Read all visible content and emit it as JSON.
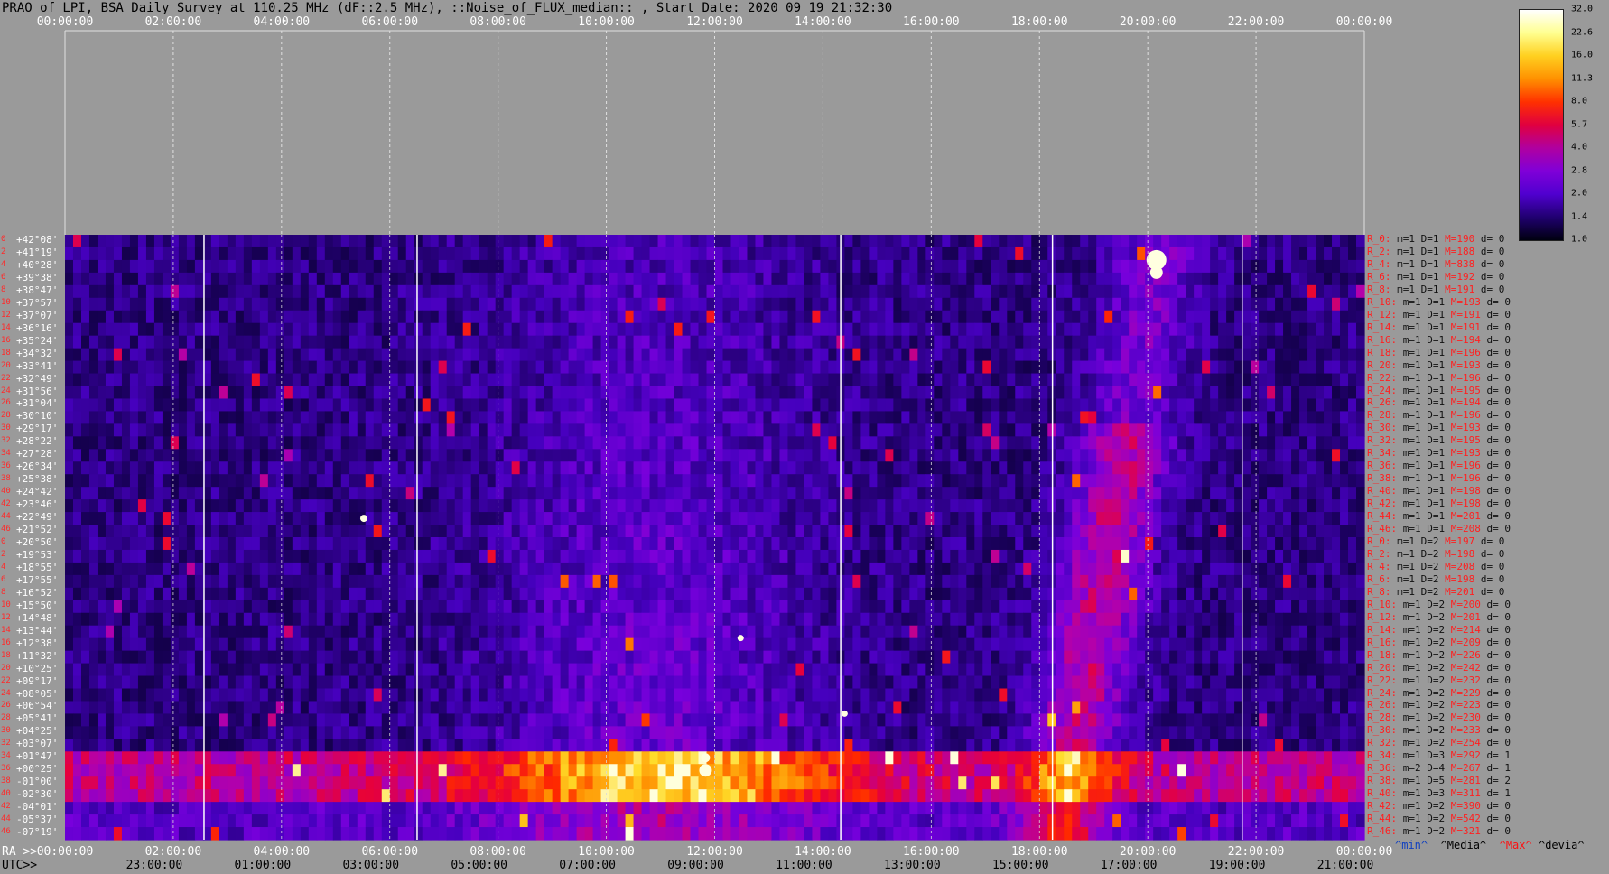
{
  "title": "PRAO of LPI, BSA Daily Survey at 110.25 MHz (dF::2.5 MHz), ::Noise_of_FLUX_median:: , Start Date: 2020 09 19 21:32:30",
  "chart_data": {
    "type": "heatmap",
    "top_axis_ticks": [
      "00:00:00",
      "02:00:00",
      "04:00:00",
      "06:00:00",
      "08:00:00",
      "10:00:00",
      "12:00:00",
      "14:00:00",
      "16:00:00",
      "18:00:00",
      "20:00:00",
      "22:00:00",
      "00:00:00"
    ],
    "ra_axis_label": "RA >>",
    "ra_axis_ticks": [
      "00:00:00",
      "02:00:00",
      "04:00:00",
      "06:00:00",
      "08:00:00",
      "10:00:00",
      "12:00:00",
      "14:00:00",
      "16:00:00",
      "18:00:00",
      "20:00:00",
      "22:00:00",
      "00:00:00"
    ],
    "utc_axis_label": "UTC>>",
    "utc_axis_ticks": [
      "23:00:00",
      "01:00:00",
      "03:00:00",
      "05:00:00",
      "07:00:00",
      "09:00:00",
      "11:00:00",
      "13:00:00",
      "15:00:00",
      "17:00:00",
      "19:00:00",
      "21:00:00"
    ],
    "declinations": [
      "+42°08'",
      "+41°19'",
      "+40°28'",
      "+39°38'",
      "+38°47'",
      "+37°57'",
      "+37°07'",
      "+36°16'",
      "+35°24'",
      "+34°32'",
      "+33°41'",
      "+32°49'",
      "+31°56'",
      "+31°04'",
      "+30°10'",
      "+29°17'",
      "+28°22'",
      "+27°28'",
      "+26°34'",
      "+25°38'",
      "+24°42'",
      "+23°46'",
      "+22°49'",
      "+21°52'",
      "+20°50'",
      "+19°53'",
      "+18°55'",
      "+17°55'",
      "+16°52'",
      "+15°50'",
      "+14°48'",
      "+13°44'",
      "+12°38'",
      "+11°32'",
      "+10°25'",
      "+09°17'",
      "+08°05'",
      "+06°54'",
      "+05°41'",
      "+04°25'",
      "+03°07'",
      "+01°47'",
      "+00°25'",
      "-01°00'",
      "-02°30'",
      "-04°01'",
      "-05°37'",
      "-07°19'"
    ],
    "row_indices": [
      "0",
      "2",
      "4",
      "6",
      "8",
      "10",
      "12",
      "14",
      "16",
      "18",
      "20",
      "22",
      "24",
      "26",
      "28",
      "30",
      "32",
      "34",
      "36",
      "38",
      "40",
      "42",
      "44",
      "46",
      "0",
      "2",
      "4",
      "6",
      "8",
      "10",
      "12",
      "14",
      "16",
      "18",
      "20",
      "22",
      "24",
      "26",
      "28",
      "30",
      "32",
      "34",
      "36",
      "38",
      "40",
      "42",
      "44",
      "46"
    ],
    "row_stats": [
      {
        "r": "R_0:",
        "m": "m=1",
        "D": "D=1",
        "M": "M=190",
        "d": "d= 0"
      },
      {
        "r": "R_2:",
        "m": "m=1",
        "D": "D=1",
        "M": "M=188",
        "d": "d= 0"
      },
      {
        "r": "R_4:",
        "m": "m=1",
        "D": "D=1",
        "M": "M=838",
        "d": "d= 0"
      },
      {
        "r": "R_6:",
        "m": "m=1",
        "D": "D=1",
        "M": "M=192",
        "d": "d= 0"
      },
      {
        "r": "R_8:",
        "m": "m=1",
        "D": "D=1",
        "M": "M=191",
        "d": "d= 0"
      },
      {
        "r": "R_10:",
        "m": "m=1",
        "D": "D=1",
        "M": "M=193",
        "d": "d= 0"
      },
      {
        "r": "R_12:",
        "m": "m=1",
        "D": "D=1",
        "M": "M=191",
        "d": "d= 0"
      },
      {
        "r": "R_14:",
        "m": "m=1",
        "D": "D=1",
        "M": "M=191",
        "d": "d= 0"
      },
      {
        "r": "R_16:",
        "m": "m=1",
        "D": "D=1",
        "M": "M=194",
        "d": "d= 0"
      },
      {
        "r": "R_18:",
        "m": "m=1",
        "D": "D=1",
        "M": "M=196",
        "d": "d= 0"
      },
      {
        "r": "R_20:",
        "m": "m=1",
        "D": "D=1",
        "M": "M=193",
        "d": "d= 0"
      },
      {
        "r": "R_22:",
        "m": "m=1",
        "D": "D=1",
        "M": "M=196",
        "d": "d= 0"
      },
      {
        "r": "R_24:",
        "m": "m=1",
        "D": "D=1",
        "M": "M=195",
        "d": "d= 0"
      },
      {
        "r": "R_26:",
        "m": "m=1",
        "D": "D=1",
        "M": "M=194",
        "d": "d= 0"
      },
      {
        "r": "R_28:",
        "m": "m=1",
        "D": "D=1",
        "M": "M=196",
        "d": "d= 0"
      },
      {
        "r": "R_30:",
        "m": "m=1",
        "D": "D=1",
        "M": "M=193",
        "d": "d= 0"
      },
      {
        "r": "R_32:",
        "m": "m=1",
        "D": "D=1",
        "M": "M=195",
        "d": "d= 0"
      },
      {
        "r": "R_34:",
        "m": "m=1",
        "D": "D=1",
        "M": "M=193",
        "d": "d= 0"
      },
      {
        "r": "R_36:",
        "m": "m=1",
        "D": "D=1",
        "M": "M=196",
        "d": "d= 0"
      },
      {
        "r": "R_38:",
        "m": "m=1",
        "D": "D=1",
        "M": "M=196",
        "d": "d= 0"
      },
      {
        "r": "R_40:",
        "m": "m=1",
        "D": "D=1",
        "M": "M=198",
        "d": "d= 0"
      },
      {
        "r": "R_42:",
        "m": "m=1",
        "D": "D=1",
        "M": "M=198",
        "d": "d= 0"
      },
      {
        "r": "R_44:",
        "m": "m=1",
        "D": "D=1",
        "M": "M=201",
        "d": "d= 0"
      },
      {
        "r": "R_46:",
        "m": "m=1",
        "D": "D=1",
        "M": "M=208",
        "d": "d= 0"
      },
      {
        "r": "R_0:",
        "m": "m=1",
        "D": "D=2",
        "M": "M=197",
        "d": "d= 0"
      },
      {
        "r": "R_2:",
        "m": "m=1",
        "D": "D=2",
        "M": "M=198",
        "d": "d= 0"
      },
      {
        "r": "R_4:",
        "m": "m=1",
        "D": "D=2",
        "M": "M=208",
        "d": "d= 0"
      },
      {
        "r": "R_6:",
        "m": "m=1",
        "D": "D=2",
        "M": "M=198",
        "d": "d= 0"
      },
      {
        "r": "R_8:",
        "m": "m=1",
        "D": "D=2",
        "M": "M=201",
        "d": "d= 0"
      },
      {
        "r": "R_10:",
        "m": "m=1",
        "D": "D=2",
        "M": "M=200",
        "d": "d= 0"
      },
      {
        "r": "R_12:",
        "m": "m=1",
        "D": "D=2",
        "M": "M=201",
        "d": "d= 0"
      },
      {
        "r": "R_14:",
        "m": "m=1",
        "D": "D=2",
        "M": "M=214",
        "d": "d= 0"
      },
      {
        "r": "R_16:",
        "m": "m=1",
        "D": "D=2",
        "M": "M=209",
        "d": "d= 0"
      },
      {
        "r": "R_18:",
        "m": "m=1",
        "D": "D=2",
        "M": "M=226",
        "d": "d= 0"
      },
      {
        "r": "R_20:",
        "m": "m=1",
        "D": "D=2",
        "M": "M=242",
        "d": "d= 0"
      },
      {
        "r": "R_22:",
        "m": "m=1",
        "D": "D=2",
        "M": "M=232",
        "d": "d= 0"
      },
      {
        "r": "R_24:",
        "m": "m=1",
        "D": "D=2",
        "M": "M=229",
        "d": "d= 0"
      },
      {
        "r": "R_26:",
        "m": "m=1",
        "D": "D=2",
        "M": "M=223",
        "d": "d= 0"
      },
      {
        "r": "R_28:",
        "m": "m=1",
        "D": "D=2",
        "M": "M=230",
        "d": "d= 0"
      },
      {
        "r": "R_30:",
        "m": "m=1",
        "D": "D=2",
        "M": "M=233",
        "d": "d= 0"
      },
      {
        "r": "R_32:",
        "m": "m=1",
        "D": "D=2",
        "M": "M=254",
        "d": "d= 0"
      },
      {
        "r": "R_34:",
        "m": "m=1",
        "D": "D=3",
        "M": "M=292",
        "d": "d= 1"
      },
      {
        "r": "R_36:",
        "m": "m=2",
        "D": "D=4",
        "M": "M=267",
        "d": "d= 1"
      },
      {
        "r": "R_38:",
        "m": "m=1",
        "D": "D=5",
        "M": "M=281",
        "d": "d= 2"
      },
      {
        "r": "R_40:",
        "m": "m=1",
        "D": "D=3",
        "M": "M=311",
        "d": "d= 1"
      },
      {
        "r": "R_42:",
        "m": "m=1",
        "D": "D=2",
        "M": "M=390",
        "d": "d= 0"
      },
      {
        "r": "R_44:",
        "m": "m=1",
        "D": "D=2",
        "M": "M=542",
        "d": "d= 0"
      },
      {
        "r": "R_46:",
        "m": "m=1",
        "D": "D=2",
        "M": "M=321",
        "d": "d= 0"
      }
    ],
    "colorbar": {
      "ticks": [
        "32.0",
        "22.6",
        "16.0",
        "11.3",
        "8.0",
        "5.7",
        "4.0",
        "2.8",
        "2.0",
        "1.4",
        "1.0"
      ],
      "colors": [
        "#ffffff",
        "#ffff90",
        "#ffd020",
        "#ff9000",
        "#ff3000",
        "#e00040",
        "#b000a0",
        "#8000d8",
        "#5000d0",
        "#200070",
        "#000010"
      ]
    },
    "legend": {
      "min": "^min^",
      "media": "^Media^",
      "max": "^Max^",
      "devia": "^devia^"
    },
    "features": [
      {
        "name": "equatorial band",
        "dec_from": "+01°47'",
        "dec_to": "-01°00'"
      },
      {
        "name": "bright source",
        "ra": "12:00:00",
        "dec": "+00°25'"
      },
      {
        "name": "bright source",
        "ra": "20:00:00",
        "dec": "+40°28'"
      },
      {
        "name": "diagonal ridge",
        "ra_from": "18:30:00",
        "ra_to": "20:00:00"
      }
    ]
  }
}
